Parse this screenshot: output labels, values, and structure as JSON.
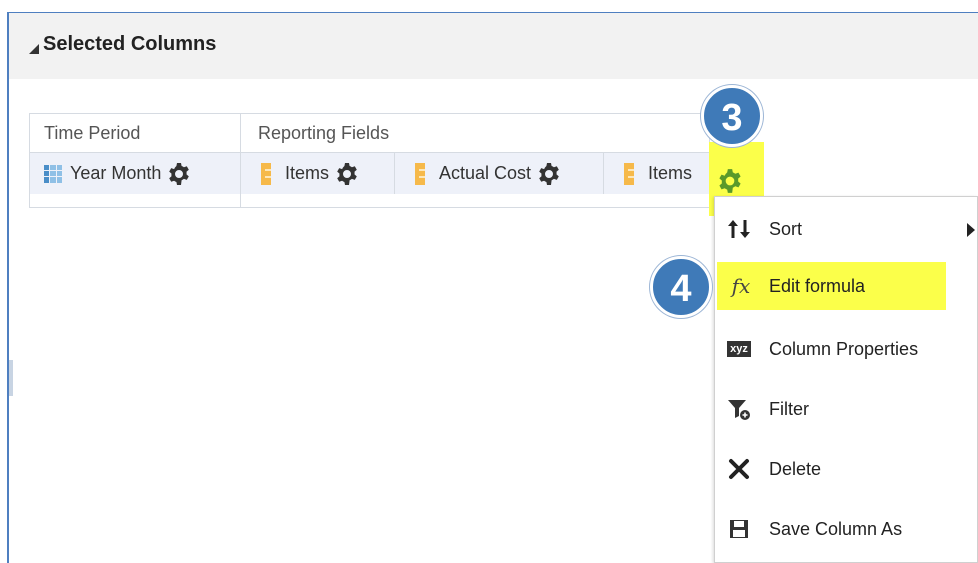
{
  "panel": {
    "title": "Selected Columns"
  },
  "groups": [
    {
      "header": "Time Period",
      "columns": [
        {
          "label": "Year Month",
          "icon": "hierarchy-grid-icon"
        }
      ]
    },
    {
      "header": "Reporting Fields",
      "columns": [
        {
          "label": "Items",
          "icon": "measure-icon"
        },
        {
          "label": "Actual Cost",
          "icon": "measure-icon"
        },
        {
          "label": "Items",
          "icon": "measure-icon"
        }
      ]
    }
  ],
  "callouts": {
    "step3": "3",
    "step4": "4"
  },
  "context_menu": {
    "items": [
      {
        "label": "Sort",
        "icon": "sort-arrows-icon",
        "has_submenu": true
      },
      {
        "label": "Edit formula",
        "icon": "fx-formula-icon",
        "highlighted": true
      },
      {
        "label": "Column Properties",
        "icon": "xyz-properties-icon"
      },
      {
        "label": "Filter",
        "icon": "filter-icon"
      },
      {
        "label": "Delete",
        "icon": "delete-x-icon"
      },
      {
        "label": "Save Column As",
        "icon": "save-icon"
      }
    ]
  },
  "colors": {
    "highlight": "#fbff4a",
    "badge": "#3f7ab8",
    "gear_active": "#5a9a2a",
    "gear": "#333333"
  }
}
